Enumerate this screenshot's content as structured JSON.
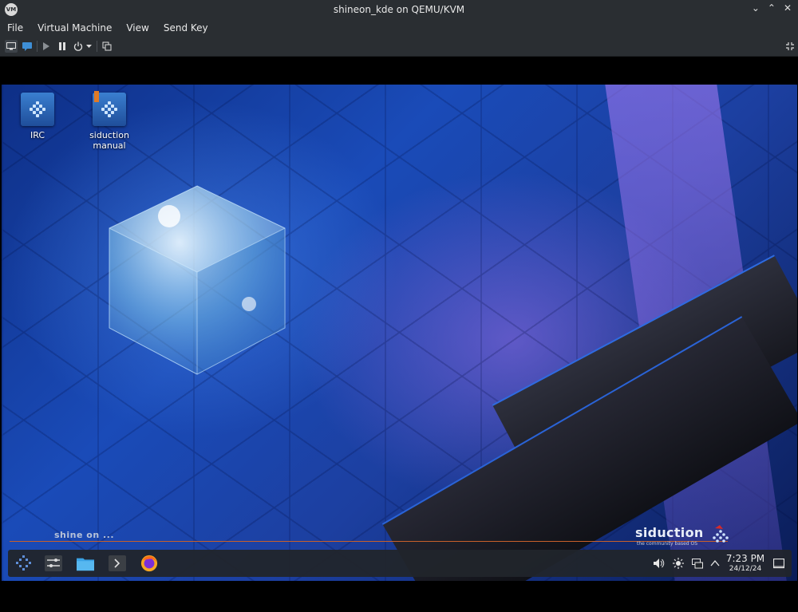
{
  "window": {
    "app_icon_text": "VM",
    "title": "shineon_kde on QEMU/KVM",
    "controls": [
      "⌄",
      "⌃",
      "✕"
    ]
  },
  "menu": {
    "items": [
      "File",
      "Virtual Machine",
      "View",
      "Send Key"
    ]
  },
  "toolbar": {
    "icons": [
      "console-icon",
      "details-icon",
      "play-icon",
      "pause-icon",
      "power-icon",
      "dropdown-arrow-icon",
      "snapshot-icon",
      "fullscreen-icon"
    ]
  },
  "desktop": {
    "icons": [
      {
        "label_lines": [
          "IRC"
        ],
        "icon": "irc-chat-icon"
      },
      {
        "label_lines": [
          "siduction",
          "manual"
        ],
        "icon": "manual-book-icon"
      }
    ],
    "tagline": "shine on ...",
    "brand_name": "siduction",
    "brand_sub": "the community based OS"
  },
  "panel": {
    "launchers": [
      "application-launcher-icon",
      "system-settings-icon",
      "file-manager-icon",
      "terminal-icon",
      "firefox-icon"
    ],
    "tray": [
      "volume-icon",
      "brightness-icon",
      "network-icon",
      "tray-expand-icon"
    ],
    "clock": {
      "time": "7:23 PM",
      "date": "24/12/24"
    },
    "show_desktop": "show-desktop-icon"
  },
  "colors": {
    "chrome": "#2a2e32",
    "panel": "#21252b",
    "accent_orange": "#c8602a",
    "desktop_blue": "#1a4bb8"
  }
}
